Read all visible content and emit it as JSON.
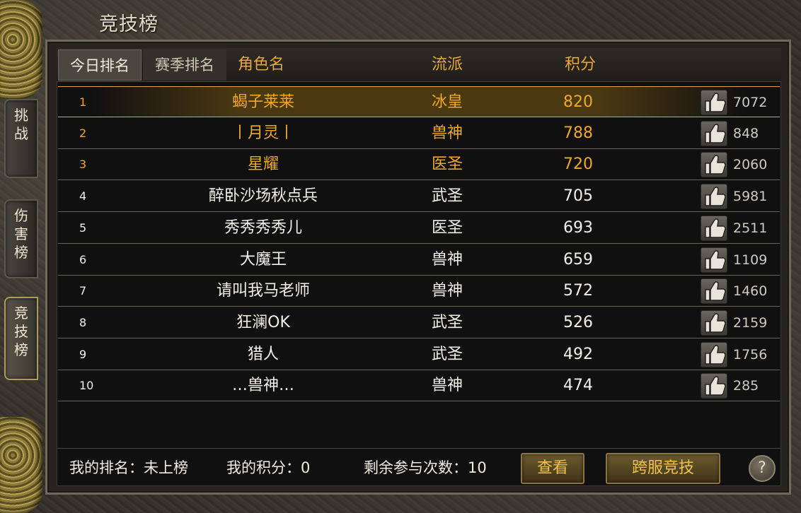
{
  "window": {
    "title": "竞技榜"
  },
  "side_tabs": [
    {
      "label": "挑战",
      "active": false
    },
    {
      "label": "伤害榜",
      "active": false
    },
    {
      "label": "竞技榜",
      "active": true
    }
  ],
  "header": {
    "tab_today": "今日排名",
    "tab_season": "赛季排名",
    "col_name": "角色名",
    "col_school": "流派",
    "col_score": "积分"
  },
  "rows": [
    {
      "rank": "1",
      "name": "蝎子莱莱",
      "school": "冰皇",
      "score": "820",
      "likes": "7072"
    },
    {
      "rank": "2",
      "name": "丨月灵丨",
      "school": "兽神",
      "score": "788",
      "likes": "848"
    },
    {
      "rank": "3",
      "name": "星耀",
      "school": "医圣",
      "score": "720",
      "likes": "2060"
    },
    {
      "rank": "4",
      "name": "醉卧沙场秋点兵",
      "school": "武圣",
      "score": "705",
      "likes": "5981"
    },
    {
      "rank": "5",
      "name": "秀秀秀秀儿",
      "school": "医圣",
      "score": "693",
      "likes": "2511"
    },
    {
      "rank": "6",
      "name": "大魔王",
      "school": "兽神",
      "score": "659",
      "likes": "1109"
    },
    {
      "rank": "7",
      "name": "请叫我马老师",
      "school": "兽神",
      "score": "572",
      "likes": "1460"
    },
    {
      "rank": "8",
      "name": "狂澜OK",
      "school": "武圣",
      "score": "526",
      "likes": "2159"
    },
    {
      "rank": "9",
      "name": "猎人",
      "school": "武圣",
      "score": "492",
      "likes": "1756"
    },
    {
      "rank": "10",
      "name": "…兽神…",
      "school": "兽神",
      "score": "474",
      "likes": "285"
    }
  ],
  "footer": {
    "my_rank": "我的排名：未上榜",
    "my_score": "我的积分：0",
    "remaining": "剩余参与次数：10",
    "view_button": "查看",
    "cross_server_button": "跨服竞技",
    "help_button": "?"
  },
  "colors": {
    "gold_text": "#f0a826",
    "header_gold": "#e7a73a"
  },
  "icons": {
    "like": "thumbs-up-icon",
    "help": "question-icon"
  }
}
